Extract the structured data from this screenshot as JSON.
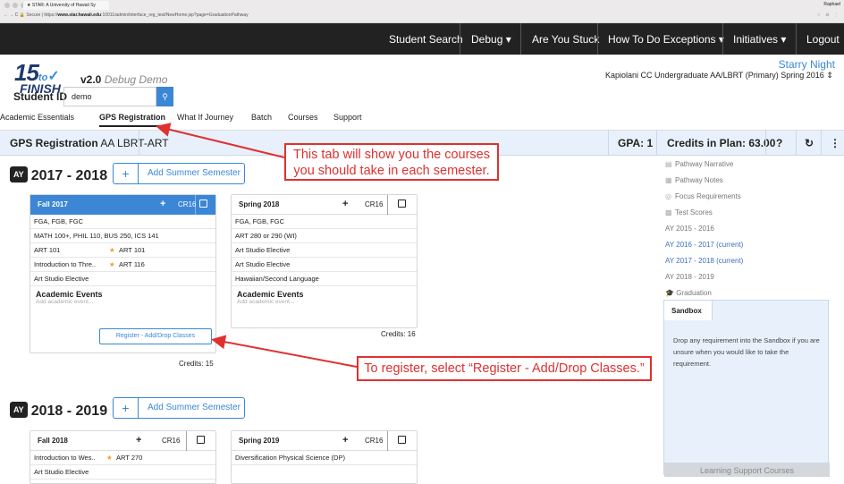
{
  "browser": {
    "tab_title": "STAR: A University of Hawaii Sy",
    "user": "Raphael",
    "secure": "Secure",
    "url_prefix": "https://",
    "url_host": "www.star.hawaii.edu",
    "url_path": ":10011/admin/interface_reg_test/NewHome.jsp?page=GraduationPathway"
  },
  "topnav": {
    "items": [
      "Student Search",
      "Debug ▾",
      "Are You Stuck",
      "How To Do Exceptions ▾",
      "Initiatives ▾",
      "Logout"
    ]
  },
  "brand": {
    "fifteen": "15",
    "to": "to",
    "finish": "FINISH",
    "version": "v2.0",
    "mode": "Debug Demo"
  },
  "student": {
    "label": "Student ID",
    "value": "demo"
  },
  "header_right": {
    "theme": "Starry Night",
    "semester_select": "Kapiolani CC Undergraduate AA/LBRT (Primary) Spring 2016"
  },
  "tabs": [
    "Academic Essentials",
    "GPS Registration",
    "What If Journey",
    "Batch",
    "Courses",
    "Support"
  ],
  "active_tab": "GPS Registration",
  "summary_bar": {
    "title": "GPS Registration",
    "program": "AA LBRT-ART",
    "gpa": "GPA: 1",
    "credits": "Credits in Plan: 63.00",
    "help": "?",
    "refresh_icon": "refresh-icon",
    "menu_icon": "kebab-menu-icon"
  },
  "years": [
    {
      "badge": "AY",
      "label": "2017 - 2018",
      "add_summer": "Add Summer Semester",
      "semesters": [
        {
          "name": "Fall 2017",
          "cr": "CR16",
          "rows": [
            "FGA, FGB, FGC",
            "MATH 100+, PHIL 110, BUS 250, ICS 141",
            "ART 101",
            "Introduction to Thre..",
            "Art Studio Elective"
          ],
          "row_extras": [
            "",
            "",
            "ART 101",
            "ART 116",
            ""
          ],
          "events_title": "Academic Events",
          "events_placeholder": "Add academic event...",
          "register": "Register - Add/Drop Classes",
          "credits": "Credits: 15"
        },
        {
          "name": "Spring 2018",
          "cr": "CR16",
          "rows": [
            "FGA, FGB, FGC",
            "ART 280 or 290 (WI)",
            "Art Studio Elective",
            "Art Studio Elective",
            "Hawaiian/Second Language"
          ],
          "events_title": "Academic Events",
          "events_placeholder": "Add academic event...",
          "credits": "Credits: 16"
        }
      ]
    },
    {
      "badge": "AY",
      "label": "2018 - 2019",
      "add_summer": "Add Summer Semester",
      "semesters": [
        {
          "name": "Fall 2018",
          "cr": "CR16",
          "rows": [
            "Introduction to Wes..",
            "Art Studio Elective"
          ],
          "row_extras": [
            "ART 270",
            ""
          ]
        },
        {
          "name": "Spring 2019",
          "cr": "CR16",
          "rows": [
            "Diversification Physical Science (DP)"
          ]
        }
      ]
    }
  ],
  "right_panel": {
    "items": [
      "Pathway Narrative",
      "Pathway Notes",
      "Focus Requirements",
      "Test Scores"
    ],
    "item_icons": [
      "document-icon",
      "notes-icon",
      "target-icon",
      "file-icon"
    ],
    "years": [
      "AY 2015 - 2016",
      "AY 2016 - 2017 (current)",
      "AY 2017 - 2018 (current)",
      "AY 2018 - 2019"
    ],
    "graduation": "Graduation",
    "sandbox_title": "Sandbox",
    "sandbox_text": "Drop any requirement into the Sandbox if you are unsure when you would like to take the requirement.",
    "learning_support": "Learning Support Courses"
  },
  "callouts": {
    "tab_note_line1": "This tab will show you the courses",
    "tab_note_line2": "you should take in each semester.",
    "register_note": "To register, select “Register - Add/Drop Classes.”"
  },
  "colors": {
    "accent": "#3b87d6",
    "nav": "#222222",
    "callout": "#e03030",
    "star": "#f0a030"
  }
}
